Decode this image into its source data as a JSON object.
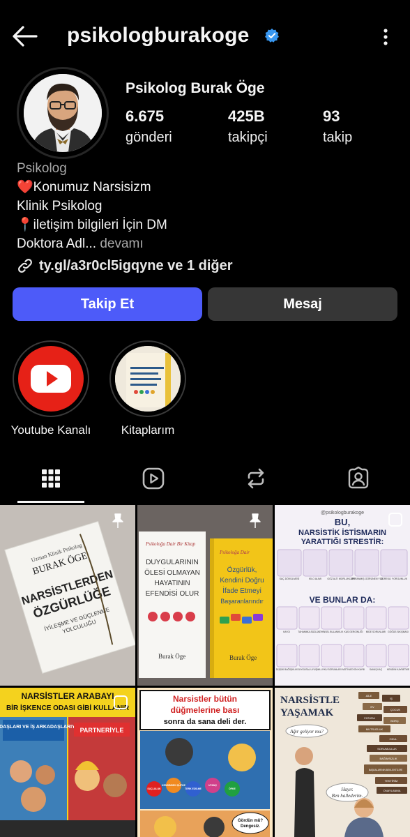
{
  "header": {
    "username": "psikologburakoge"
  },
  "profile": {
    "full_name": "Psikolog Burak Öge",
    "stats": [
      {
        "value": "6.675",
        "label": "gönderi"
      },
      {
        "value": "425B",
        "label": "takipçi"
      },
      {
        "value": "93",
        "label": "takip"
      }
    ],
    "bio": {
      "category": "Psikolog",
      "line1": "❤️Konumuz Narsisizm",
      "line2": "Klinik Psikolog",
      "line3": "📍iletişim bilgileri İçin DM",
      "line4": "Doktora Adl...",
      "more": "devamı"
    },
    "link": "ty.gl/a3r0cl5igqyne ve 1 diğer"
  },
  "actions": {
    "follow": "Takip Et",
    "message": "Mesaj"
  },
  "highlights": [
    {
      "label": "Youtube Kanalı",
      "icon": "youtube-icon"
    },
    {
      "label": "Kitaplarım",
      "icon": "book-cover"
    }
  ],
  "tabs": [
    {
      "name": "grid",
      "icon": "grid-icon",
      "active": true
    },
    {
      "name": "reels",
      "icon": "reels-icon"
    },
    {
      "name": "reposts",
      "icon": "repost-icon"
    },
    {
      "name": "tagged",
      "icon": "tagged-icon"
    }
  ],
  "posts": {
    "p1": {
      "pinned": true,
      "author_line": "Uzman Klinik Psikolog",
      "author": "BURAK ÖGE",
      "title1": "NARSİSTLERDEN",
      "title2": "ÖZGÜRLÜĞE",
      "subtitle1": "İYİLEŞME VE GÜÇLENME",
      "subtitle2": "YOLCULUĞU"
    },
    "p2": {
      "pinned": true,
      "b1_top": "Psikoloğa Dair Bir Kitap",
      "b1_t1": "DUYGULARININ",
      "b1_t2": "ÖLESİ OLMAYAN",
      "b1_t3": "HAYATININ",
      "b1_t4": "EFENDİSİ OLUR",
      "b1_author": "Burak Öge",
      "b2_top": "Psikoloğa Dair",
      "b2_t1": "Özgürlük,",
      "b2_t2": "Kendini Doğru",
      "b2_t3": "İfade Etmeyi",
      "b2_t4": "Başaranlarındır",
      "b2_author": "Burak Öge"
    },
    "p3": {
      "handle": "@psikologburakoge",
      "title1": "BU,",
      "title2": "NARSİSTİK İSTİSMARIN",
      "title3": "YARATTIĞI STRESTİR:",
      "sub": "VE BUNLAR DA:",
      "row1": [
        "SAÇ DÖKÜLMESİ",
        "KİLO ALIMI",
        "GÖZ ALTI MORLUKLARI",
        "TİPİRANMIŞ GÖRÜNEN YÜZ",
        "SÜREKLİ YORGUNLUK"
      ],
      "row2": [
        "KAYGI",
        "TAHAMMÜLSÜZLÜK",
        "ZİHİNSEL BULANIKLIK",
        "KAS GERGİNLİĞİ",
        "MİDE SORUNLARI",
        "GÖĞÜS SIKIŞMASI"
      ],
      "row3": [
        "DÜŞÜK BAĞIŞIKLIK",
        "DUYGUSAL UYUŞMA",
        "UYKU SORUNLARI",
        "MOTİVASYON KAYBI",
        "SAVAŞ KAÇ",
        "KENDİNİ KAYBETME"
      ]
    },
    "p4": {
      "title1": "NARSİSTLER ARABAYI",
      "title2": "BİR İŞKENCE ODASI GİBİ KULLANIR",
      "left": "ARKADAŞLARI VE İŞ ARKADAŞLARIYLA",
      "right": "PARTNERİYLE"
    },
    "p5": {
      "title1": "Narsistler bütün",
      "title2": "düğmelerine bası",
      "title3": "sonra da sana deli der.",
      "b1": "SUÇLULUK",
      "b2": "KENDİNDEN ŞÜPHE",
      "b3": "TERK EDİLME",
      "b4": "UTANÇ",
      "b5": "ÖFKE",
      "speech1": "Gördün mü?",
      "speech2": "Dengesiz."
    },
    "p6": {
      "title1": "NARSİSTLE",
      "title2": "YAŞAMAK",
      "q": "Ağır geliyor mu?",
      "a1": "Hayır.",
      "a2": "Ben hallederim.",
      "tags": [
        "AİLE",
        "İŞ",
        "EV",
        "ÇOCUK",
        "FATURA",
        "BORÇ",
        "MUTSUZLUK",
        "OKUL",
        "SORUMLULUK",
        "BAĞIMSIZLIK",
        "BAŞKALARININ BEKLENTİLERİ",
        "TEKTİRİM",
        "ONAYLANMA"
      ]
    }
  },
  "colors": {
    "follow": "#4d5bf9",
    "message": "#363636",
    "verified": "#3897f0",
    "youtube": "#e62117"
  }
}
